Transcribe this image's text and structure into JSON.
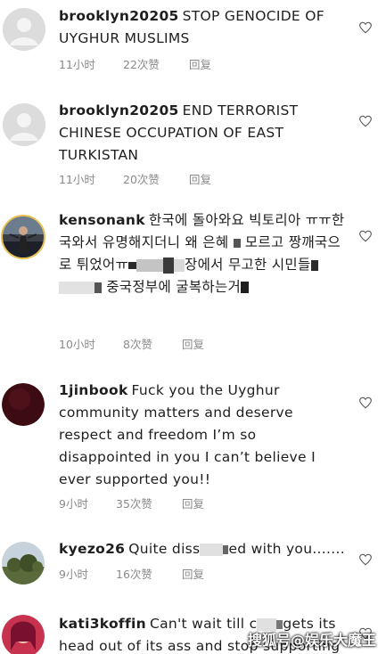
{
  "comments": [
    {
      "username": "brooklyn20205",
      "text": "STOP GENOCIDE OF UYGHUR MUSLIMS",
      "time": "11小时",
      "likes": "22次赞",
      "reply": "回复"
    },
    {
      "username": "brooklyn20205",
      "text": "END TERRORIST CHINESE OCCUPATION OF EAST TURKISTAN",
      "time": "11小时",
      "likes": "20次赞",
      "reply": "回复"
    },
    {
      "username": "kensonank",
      "text_a": "한국에 돌아와요 빅토리아 ㅠㅠ한국와서 유명해지더니 왜 은혜",
      "text_b": "모르고 짱깨국으로 튀었어ㅠ",
      "text_c": "장에서 무고한 시민들",
      "text_d": "중국정부에 굴복하는거",
      "time": "10小时",
      "likes": "8次赞",
      "reply": "回复"
    },
    {
      "username": "1jinbook",
      "text": "Fuck you the Uyghur community  matters and deserve respect and freedom I’m so disappointed in you I can’t believe I ever supported you!!",
      "time": "9小时",
      "likes": "35次赞",
      "reply": "回复"
    },
    {
      "username": "kyezo26",
      "text_a": "Quite diss",
      "text_b": "ed with you.......",
      "time": "9小时",
      "likes": "16次赞",
      "reply": "回复"
    },
    {
      "username": "kati3koffin",
      "text_a": "Can't wait till c",
      "text_b": "gets its head out of its ass and stop supporting"
    }
  ],
  "watermark": "搜狐号@娱乐大魔王",
  "colors": {
    "text": "#1e1e1e",
    "meta": "#8a8a8a",
    "background": "#ffffff"
  }
}
